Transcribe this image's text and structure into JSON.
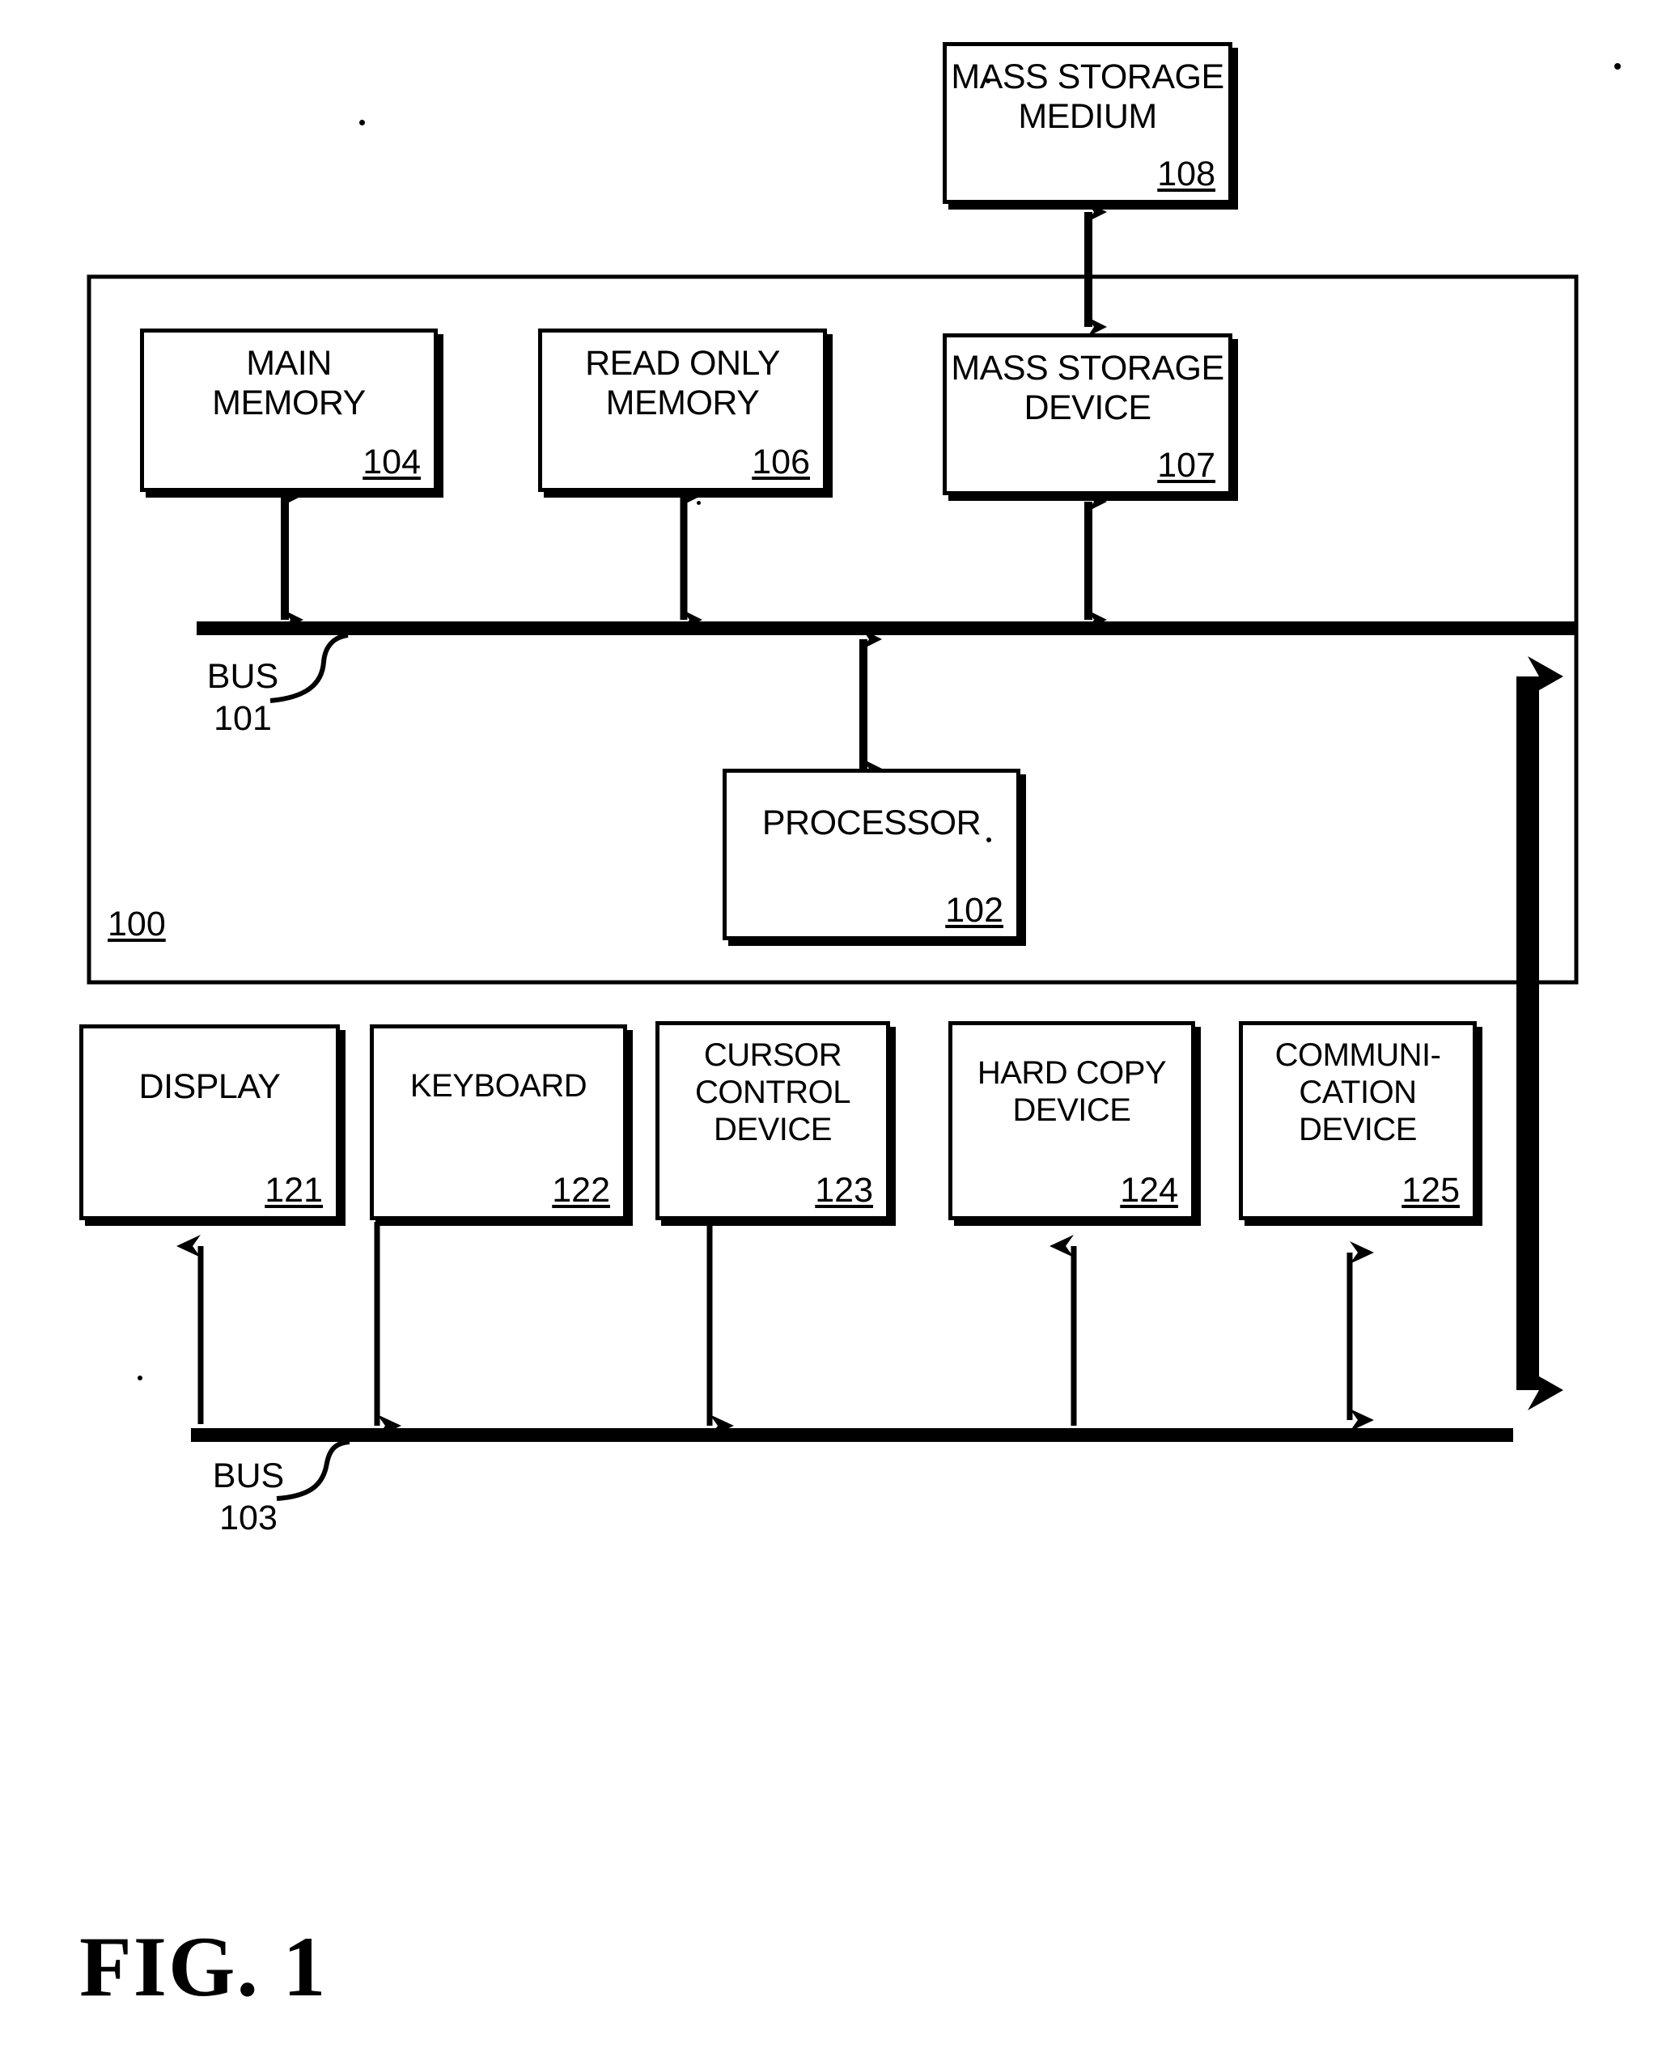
{
  "figure": {
    "caption": "FIG. 1",
    "type": "patent-block-diagram"
  },
  "system": {
    "label_ref": "100"
  },
  "blocks": {
    "mass_storage_medium": {
      "title": "MASS STORAGE\nMEDIUM",
      "ref": "108"
    },
    "main_memory": {
      "title": "MAIN\nMEMORY",
      "ref": "104"
    },
    "read_only_memory": {
      "title": "READ ONLY\nMEMORY",
      "ref": "106"
    },
    "mass_storage_device": {
      "title": "MASS STORAGE\nDEVICE",
      "ref": "107"
    },
    "processor": {
      "title": "PROCESSOR",
      "ref": "102"
    },
    "display": {
      "title": "DISPLAY",
      "ref": "121"
    },
    "keyboard": {
      "title": "KEYBOARD",
      "ref": "122"
    },
    "cursor_control": {
      "title": "CURSOR\nCONTROL\nDEVICE",
      "ref": "123"
    },
    "hard_copy": {
      "title": "HARD COPY\nDEVICE",
      "ref": "124"
    },
    "communication": {
      "title": "COMMUNI-\nCATION\nDEVICE",
      "ref": "125"
    }
  },
  "buses": {
    "top": {
      "name": "BUS",
      "ref": "101",
      "label": "BUS\n101"
    },
    "bottom": {
      "name": "BUS",
      "ref": "103",
      "label": "BUS\n103"
    }
  },
  "colors": {
    "ink": "#000000",
    "paper": "#ffffff"
  }
}
